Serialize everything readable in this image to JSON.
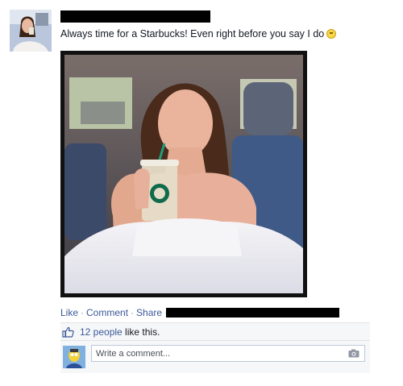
{
  "post": {
    "author_avatar_icon": "profile-photo",
    "text": "Always time for a Starbucks! Even right before you say I do",
    "emoji_icon": "smiley-icon",
    "photo_icon": "post-photo"
  },
  "actions": {
    "like": "Like",
    "comment": "Comment",
    "share": "Share",
    "separator": "·"
  },
  "likes": {
    "people": "12 people",
    "suffix": " like this."
  },
  "comment_box": {
    "placeholder": "Write a comment...",
    "camera_icon": "camera-icon"
  },
  "colors": {
    "link": "#3b5998",
    "ufi_background": "#f6f7f9",
    "redaction": "#000000"
  }
}
